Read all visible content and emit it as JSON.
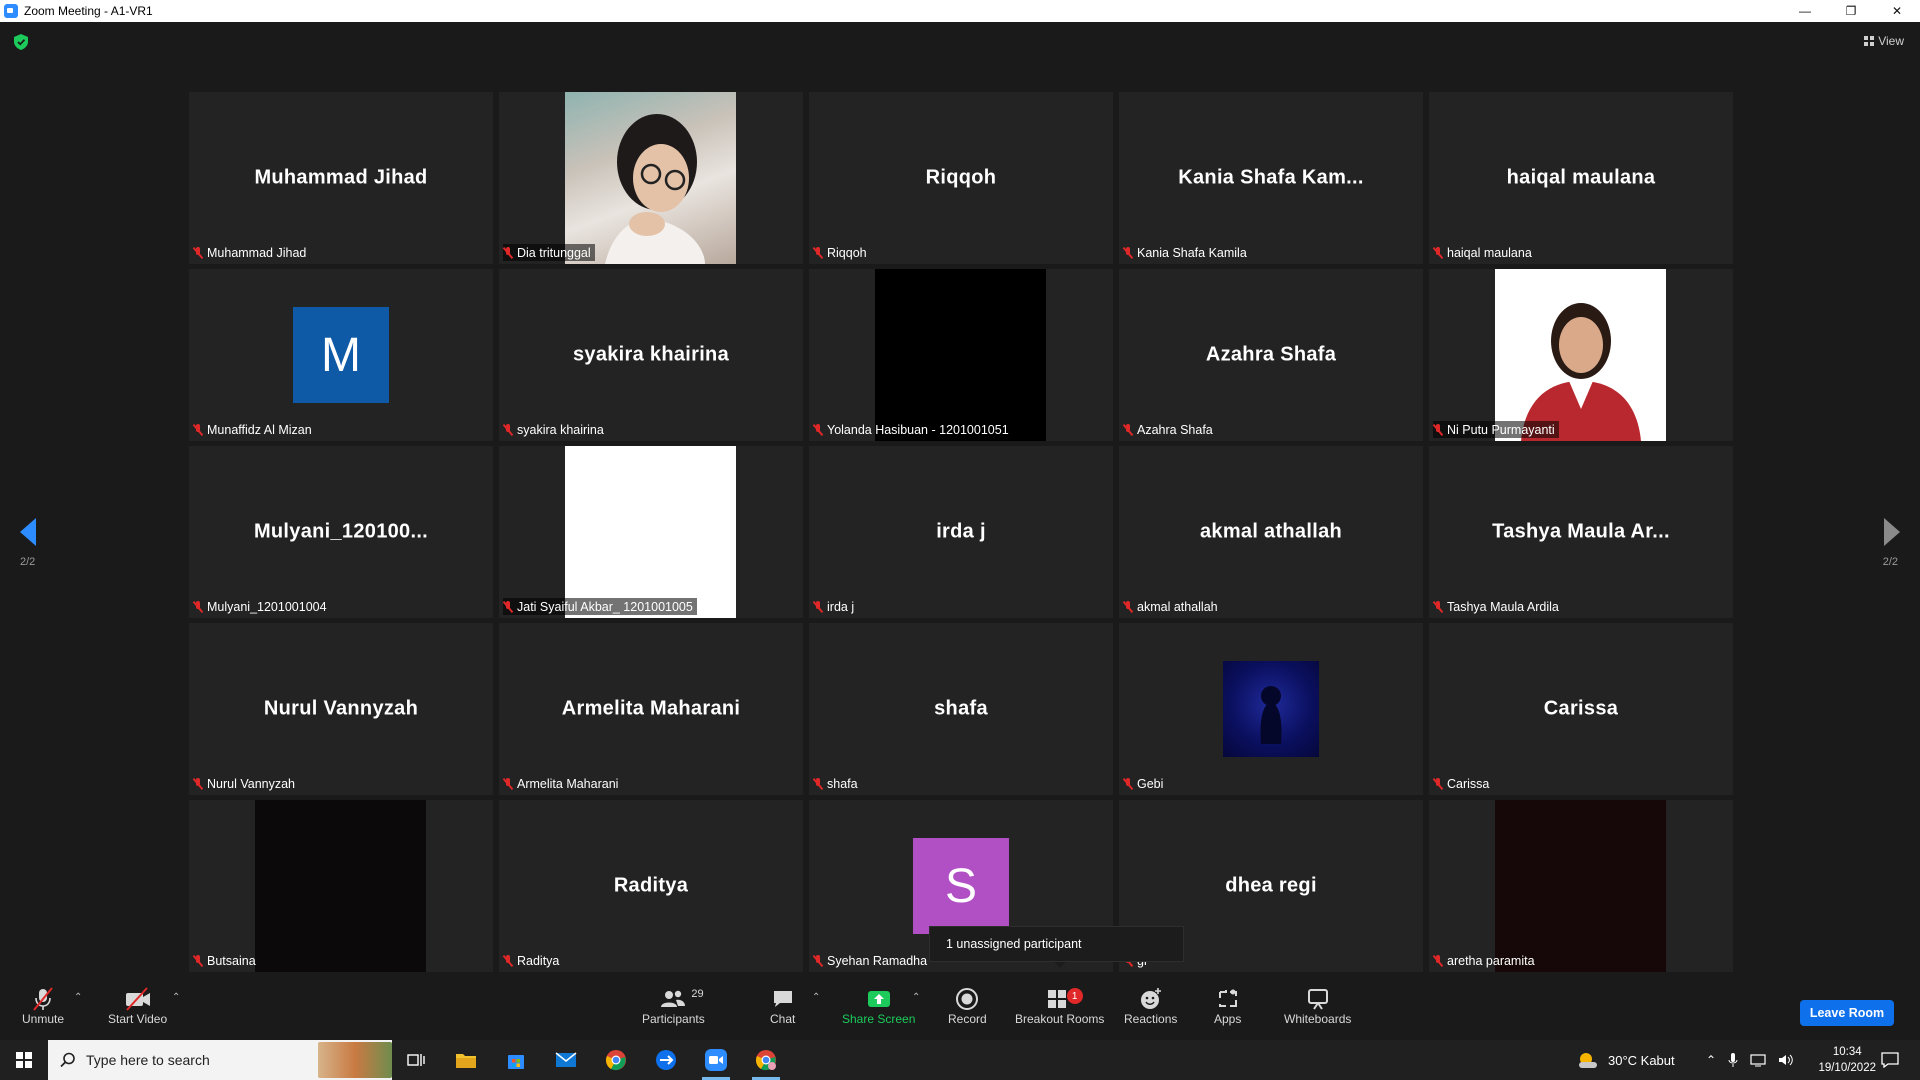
{
  "window": {
    "title": "Zoom Meeting - A1-VR1"
  },
  "view_label": "View",
  "pages": {
    "left": "2/2",
    "right": "2/2"
  },
  "tiles": [
    {
      "display": "Muhammad Jihad",
      "label": "Muhammad Jihad",
      "kind": "name"
    },
    {
      "display": "",
      "label": "Dia tritunggal",
      "kind": "video-photo"
    },
    {
      "display": "Riqqoh",
      "label": "Riqqoh",
      "kind": "name"
    },
    {
      "display": "Kania  Shafa  Kam...",
      "label": "Kania Shafa Kamila",
      "kind": "name"
    },
    {
      "display": "haiqal maulana",
      "label": "haiqal maulana",
      "kind": "name"
    },
    {
      "display": "M",
      "label": "Munaffidz Al Mizan",
      "kind": "avatar-blue"
    },
    {
      "display": "syakira khairina",
      "label": "syakira khairina",
      "kind": "name"
    },
    {
      "display": "",
      "label": "Yolanda Hasibuan - 1201001051",
      "kind": "video-black"
    },
    {
      "display": "Azahra Shafa",
      "label": "Azahra Shafa",
      "kind": "name"
    },
    {
      "display": "",
      "label": "Ni Putu Purmayanti",
      "kind": "video-portrait"
    },
    {
      "display": "Mulyani_120100...",
      "label": "Mulyani_1201001004",
      "kind": "name"
    },
    {
      "display": "",
      "label": "Jati Syaiful Akbar_ 1201001005",
      "kind": "video-white"
    },
    {
      "display": "irda j",
      "label": "irda j",
      "kind": "name"
    },
    {
      "display": "akmal athallah",
      "label": "akmal athallah",
      "kind": "name"
    },
    {
      "display": "Tashya Maula Ar...",
      "label": "Tashya Maula Ardila",
      "kind": "name"
    },
    {
      "display": "Nurul Vannyzah",
      "label": "Nurul Vannyzah",
      "kind": "name"
    },
    {
      "display": "Armelita Maharani",
      "label": "Armelita Maharani",
      "kind": "name"
    },
    {
      "display": "shafa",
      "label": "shafa",
      "kind": "name"
    },
    {
      "display": "",
      "label": "Gebi",
      "kind": "avatar-image"
    },
    {
      "display": "Carissa",
      "label": "Carissa",
      "kind": "name"
    },
    {
      "display": "",
      "label": "Butsaina",
      "kind": "video-dark"
    },
    {
      "display": "Raditya",
      "label": "Raditya",
      "kind": "name"
    },
    {
      "display": "S",
      "label": "Syehan Ramadha",
      "kind": "avatar-purple"
    },
    {
      "display": "dhea regi",
      "label": "gi",
      "kind": "name"
    },
    {
      "display": "",
      "label": "aretha paramita",
      "kind": "video-darkred"
    }
  ],
  "tooltip": "1 unassigned participant",
  "toolbar": {
    "unmute": "Unmute",
    "start_video": "Start Video",
    "participants": "Participants",
    "participants_count": "29",
    "chat": "Chat",
    "share_screen": "Share Screen",
    "record": "Record",
    "breakout_rooms": "Breakout Rooms",
    "breakout_badge": "1",
    "reactions": "Reactions",
    "apps": "Apps",
    "whiteboards": "Whiteboards",
    "leave": "Leave Room"
  },
  "taskbar": {
    "search_placeholder": "Type here to search",
    "weather": "30°C  Kabut",
    "time": "10:34",
    "date": "19/10/2022"
  },
  "colors": {
    "accent": "#2D8CFF",
    "share_green": "#1CCB5B",
    "muted_red": "#E02828",
    "leave_blue": "#0E71EB",
    "avatar_blue": "#0E5AA7",
    "avatar_purple": "#B14FC5"
  }
}
